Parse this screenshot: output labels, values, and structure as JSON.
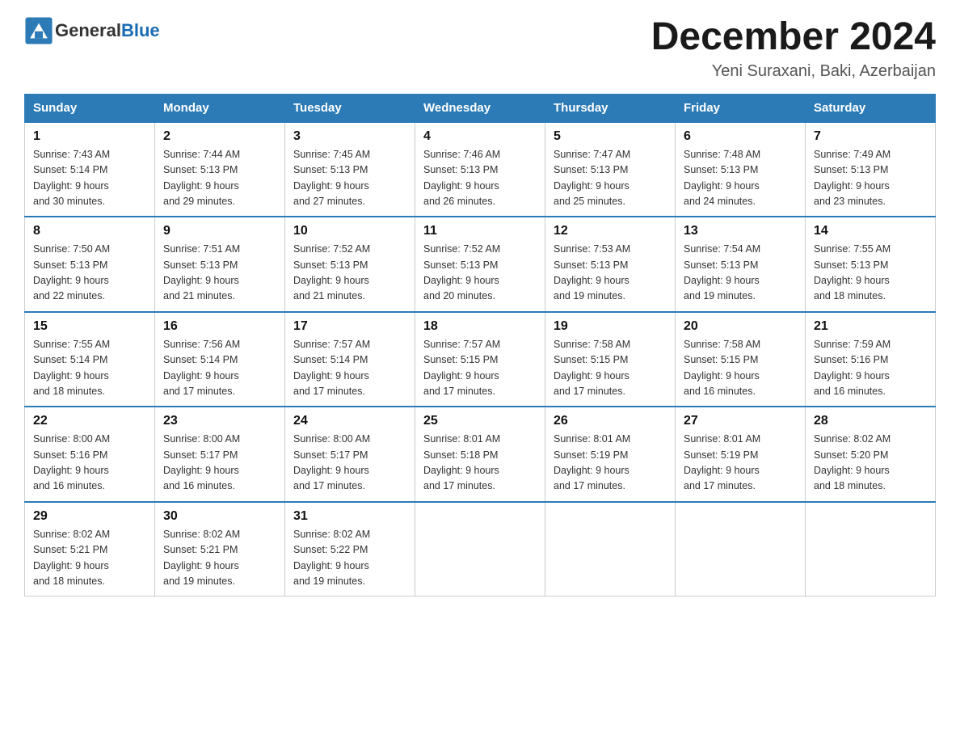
{
  "header": {
    "logo_general": "General",
    "logo_blue": "Blue",
    "month_year": "December 2024",
    "location": "Yeni Suraxani, Baki, Azerbaijan"
  },
  "days_of_week": [
    "Sunday",
    "Monday",
    "Tuesday",
    "Wednesday",
    "Thursday",
    "Friday",
    "Saturday"
  ],
  "weeks": [
    [
      {
        "day": "1",
        "sunrise": "7:43 AM",
        "sunset": "5:14 PM",
        "daylight": "9 hours and 30 minutes."
      },
      {
        "day": "2",
        "sunrise": "7:44 AM",
        "sunset": "5:13 PM",
        "daylight": "9 hours and 29 minutes."
      },
      {
        "day": "3",
        "sunrise": "7:45 AM",
        "sunset": "5:13 PM",
        "daylight": "9 hours and 27 minutes."
      },
      {
        "day": "4",
        "sunrise": "7:46 AM",
        "sunset": "5:13 PM",
        "daylight": "9 hours and 26 minutes."
      },
      {
        "day": "5",
        "sunrise": "7:47 AM",
        "sunset": "5:13 PM",
        "daylight": "9 hours and 25 minutes."
      },
      {
        "day": "6",
        "sunrise": "7:48 AM",
        "sunset": "5:13 PM",
        "daylight": "9 hours and 24 minutes."
      },
      {
        "day": "7",
        "sunrise": "7:49 AM",
        "sunset": "5:13 PM",
        "daylight": "9 hours and 23 minutes."
      }
    ],
    [
      {
        "day": "8",
        "sunrise": "7:50 AM",
        "sunset": "5:13 PM",
        "daylight": "9 hours and 22 minutes."
      },
      {
        "day": "9",
        "sunrise": "7:51 AM",
        "sunset": "5:13 PM",
        "daylight": "9 hours and 21 minutes."
      },
      {
        "day": "10",
        "sunrise": "7:52 AM",
        "sunset": "5:13 PM",
        "daylight": "9 hours and 21 minutes."
      },
      {
        "day": "11",
        "sunrise": "7:52 AM",
        "sunset": "5:13 PM",
        "daylight": "9 hours and 20 minutes."
      },
      {
        "day": "12",
        "sunrise": "7:53 AM",
        "sunset": "5:13 PM",
        "daylight": "9 hours and 19 minutes."
      },
      {
        "day": "13",
        "sunrise": "7:54 AM",
        "sunset": "5:13 PM",
        "daylight": "9 hours and 19 minutes."
      },
      {
        "day": "14",
        "sunrise": "7:55 AM",
        "sunset": "5:13 PM",
        "daylight": "9 hours and 18 minutes."
      }
    ],
    [
      {
        "day": "15",
        "sunrise": "7:55 AM",
        "sunset": "5:14 PM",
        "daylight": "9 hours and 18 minutes."
      },
      {
        "day": "16",
        "sunrise": "7:56 AM",
        "sunset": "5:14 PM",
        "daylight": "9 hours and 17 minutes."
      },
      {
        "day": "17",
        "sunrise": "7:57 AM",
        "sunset": "5:14 PM",
        "daylight": "9 hours and 17 minutes."
      },
      {
        "day": "18",
        "sunrise": "7:57 AM",
        "sunset": "5:15 PM",
        "daylight": "9 hours and 17 minutes."
      },
      {
        "day": "19",
        "sunrise": "7:58 AM",
        "sunset": "5:15 PM",
        "daylight": "9 hours and 17 minutes."
      },
      {
        "day": "20",
        "sunrise": "7:58 AM",
        "sunset": "5:15 PM",
        "daylight": "9 hours and 16 minutes."
      },
      {
        "day": "21",
        "sunrise": "7:59 AM",
        "sunset": "5:16 PM",
        "daylight": "9 hours and 16 minutes."
      }
    ],
    [
      {
        "day": "22",
        "sunrise": "8:00 AM",
        "sunset": "5:16 PM",
        "daylight": "9 hours and 16 minutes."
      },
      {
        "day": "23",
        "sunrise": "8:00 AM",
        "sunset": "5:17 PM",
        "daylight": "9 hours and 16 minutes."
      },
      {
        "day": "24",
        "sunrise": "8:00 AM",
        "sunset": "5:17 PM",
        "daylight": "9 hours and 17 minutes."
      },
      {
        "day": "25",
        "sunrise": "8:01 AM",
        "sunset": "5:18 PM",
        "daylight": "9 hours and 17 minutes."
      },
      {
        "day": "26",
        "sunrise": "8:01 AM",
        "sunset": "5:19 PM",
        "daylight": "9 hours and 17 minutes."
      },
      {
        "day": "27",
        "sunrise": "8:01 AM",
        "sunset": "5:19 PM",
        "daylight": "9 hours and 17 minutes."
      },
      {
        "day": "28",
        "sunrise": "8:02 AM",
        "sunset": "5:20 PM",
        "daylight": "9 hours and 18 minutes."
      }
    ],
    [
      {
        "day": "29",
        "sunrise": "8:02 AM",
        "sunset": "5:21 PM",
        "daylight": "9 hours and 18 minutes."
      },
      {
        "day": "30",
        "sunrise": "8:02 AM",
        "sunset": "5:21 PM",
        "daylight": "9 hours and 19 minutes."
      },
      {
        "day": "31",
        "sunrise": "8:02 AM",
        "sunset": "5:22 PM",
        "daylight": "9 hours and 19 minutes."
      },
      null,
      null,
      null,
      null
    ]
  ],
  "labels": {
    "sunrise_prefix": "Sunrise: ",
    "sunset_prefix": "Sunset: ",
    "daylight_prefix": "Daylight: "
  }
}
